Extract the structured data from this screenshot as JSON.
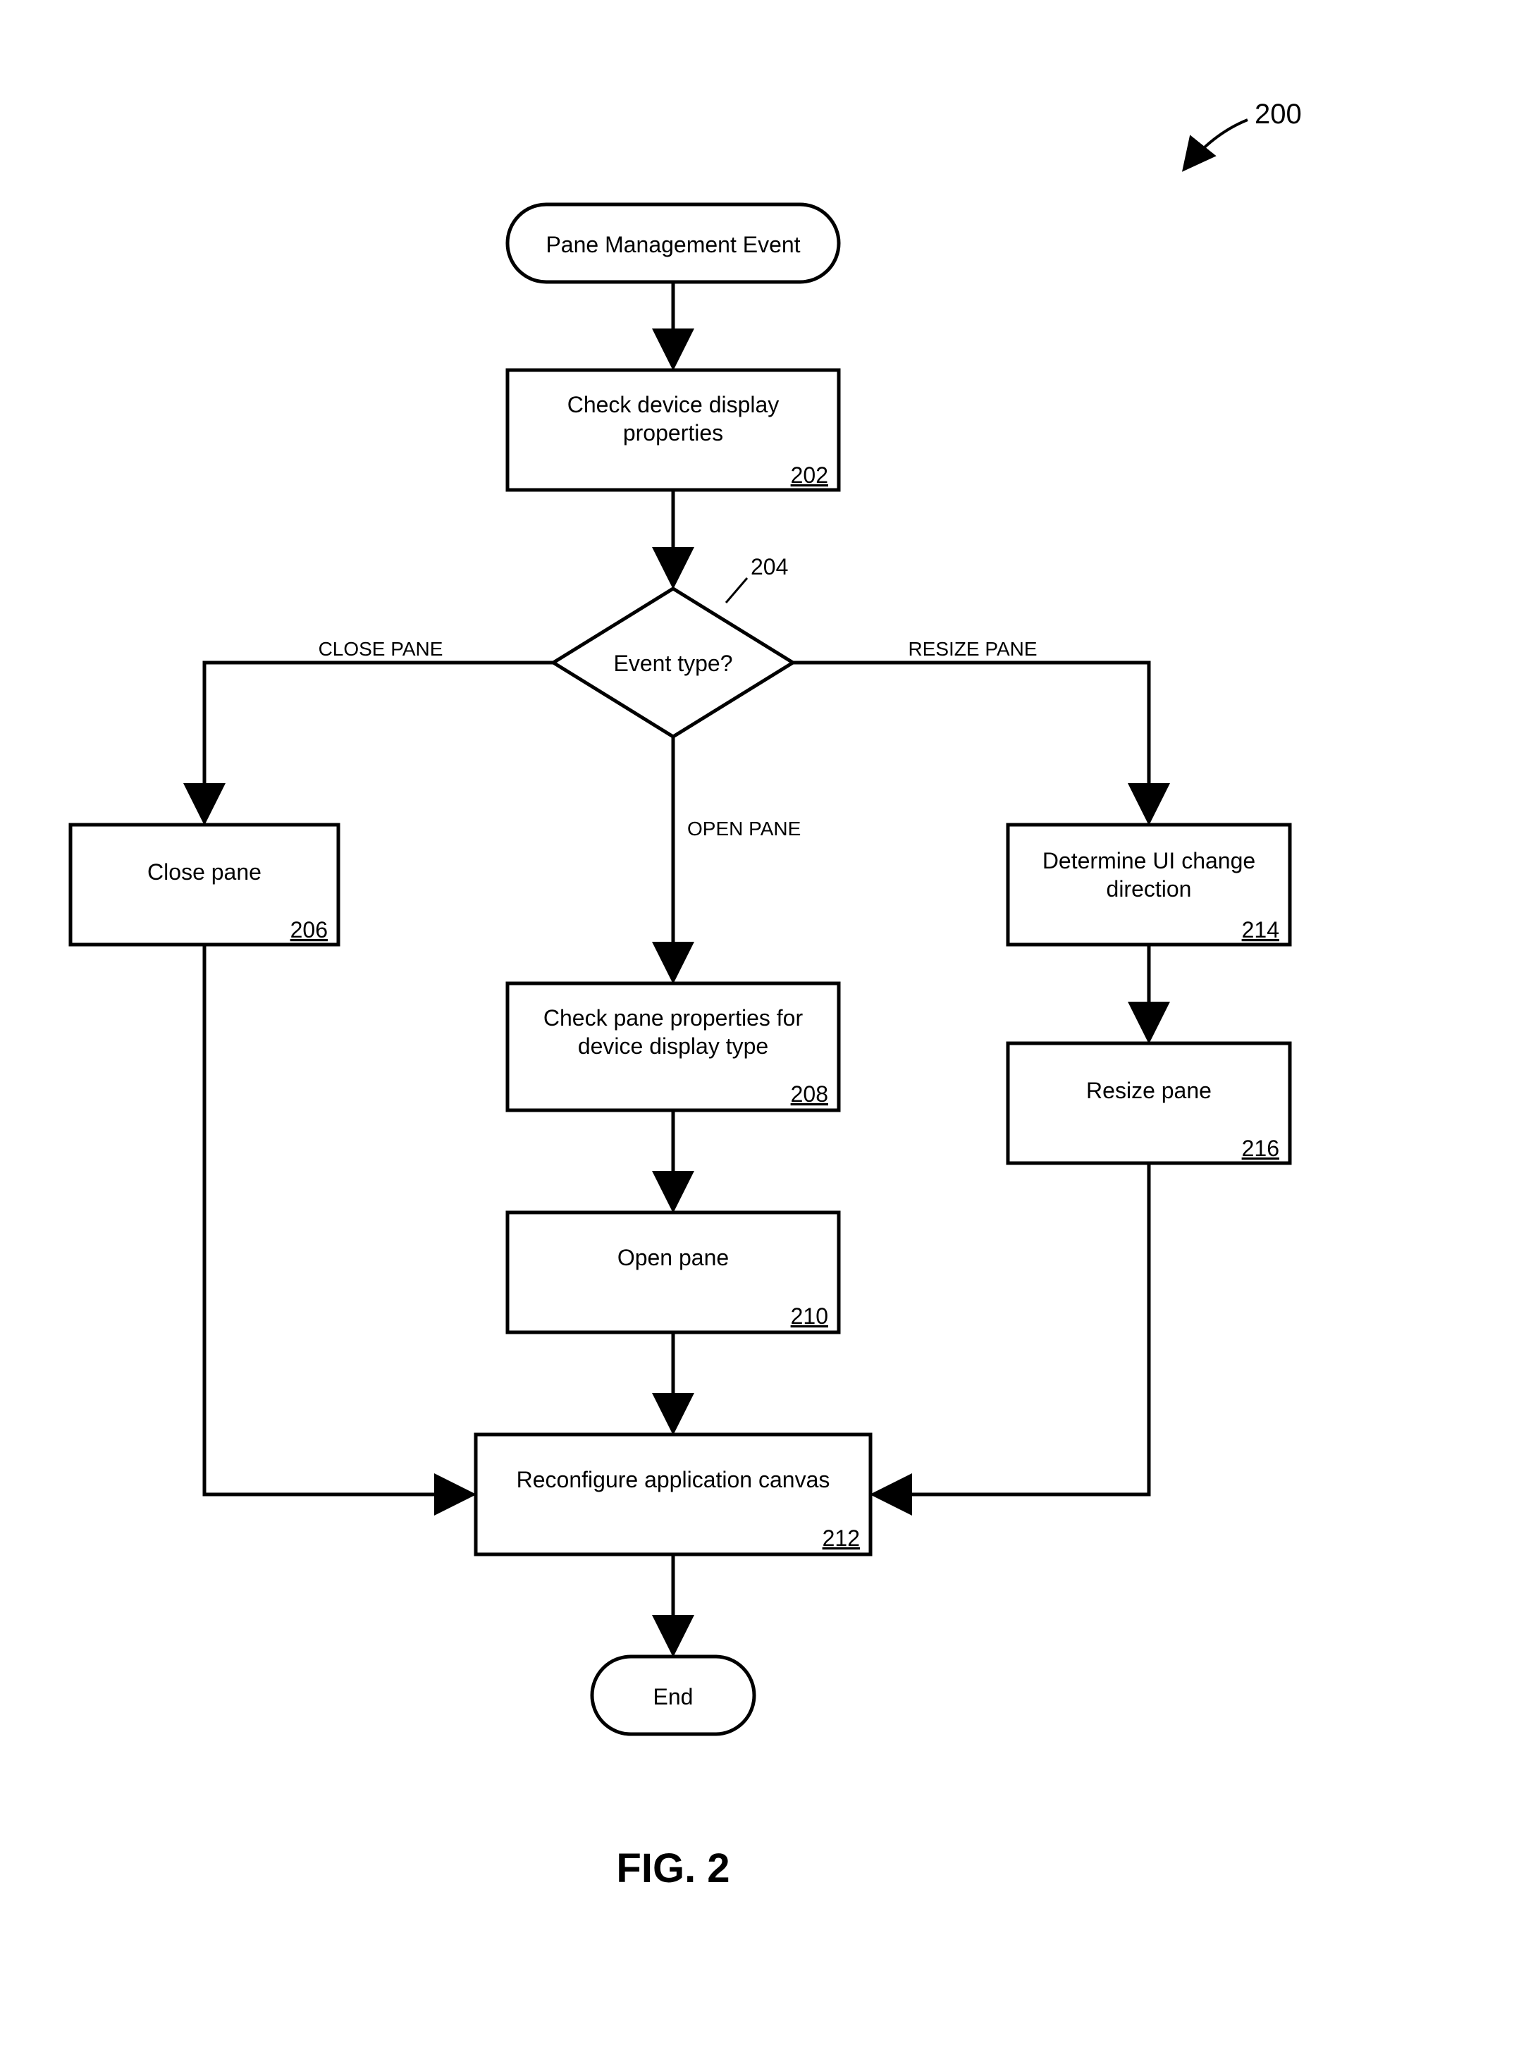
{
  "figure": {
    "label": "FIG. 2",
    "annotation": "200"
  },
  "nodes": {
    "start": {
      "text": "Pane Management Event"
    },
    "n202": {
      "text1": "Check device display",
      "text2": "properties",
      "ref": "202"
    },
    "decision": {
      "text": "Event type?",
      "ref": "204"
    },
    "n206": {
      "text": "Close pane",
      "ref": "206"
    },
    "n208": {
      "text1": "Check pane properties for",
      "text2": "device display type",
      "ref": "208"
    },
    "n210": {
      "text": "Open pane",
      "ref": "210"
    },
    "n212": {
      "text": "Reconfigure application canvas",
      "ref": "212"
    },
    "n214": {
      "text1": "Determine UI change",
      "text2": "direction",
      "ref": "214"
    },
    "n216": {
      "text": "Resize pane",
      "ref": "216"
    },
    "end": {
      "text": "End"
    }
  },
  "edge_labels": {
    "close": "CLOSE PANE",
    "open": "OPEN PANE",
    "resize": "RESIZE PANE"
  }
}
